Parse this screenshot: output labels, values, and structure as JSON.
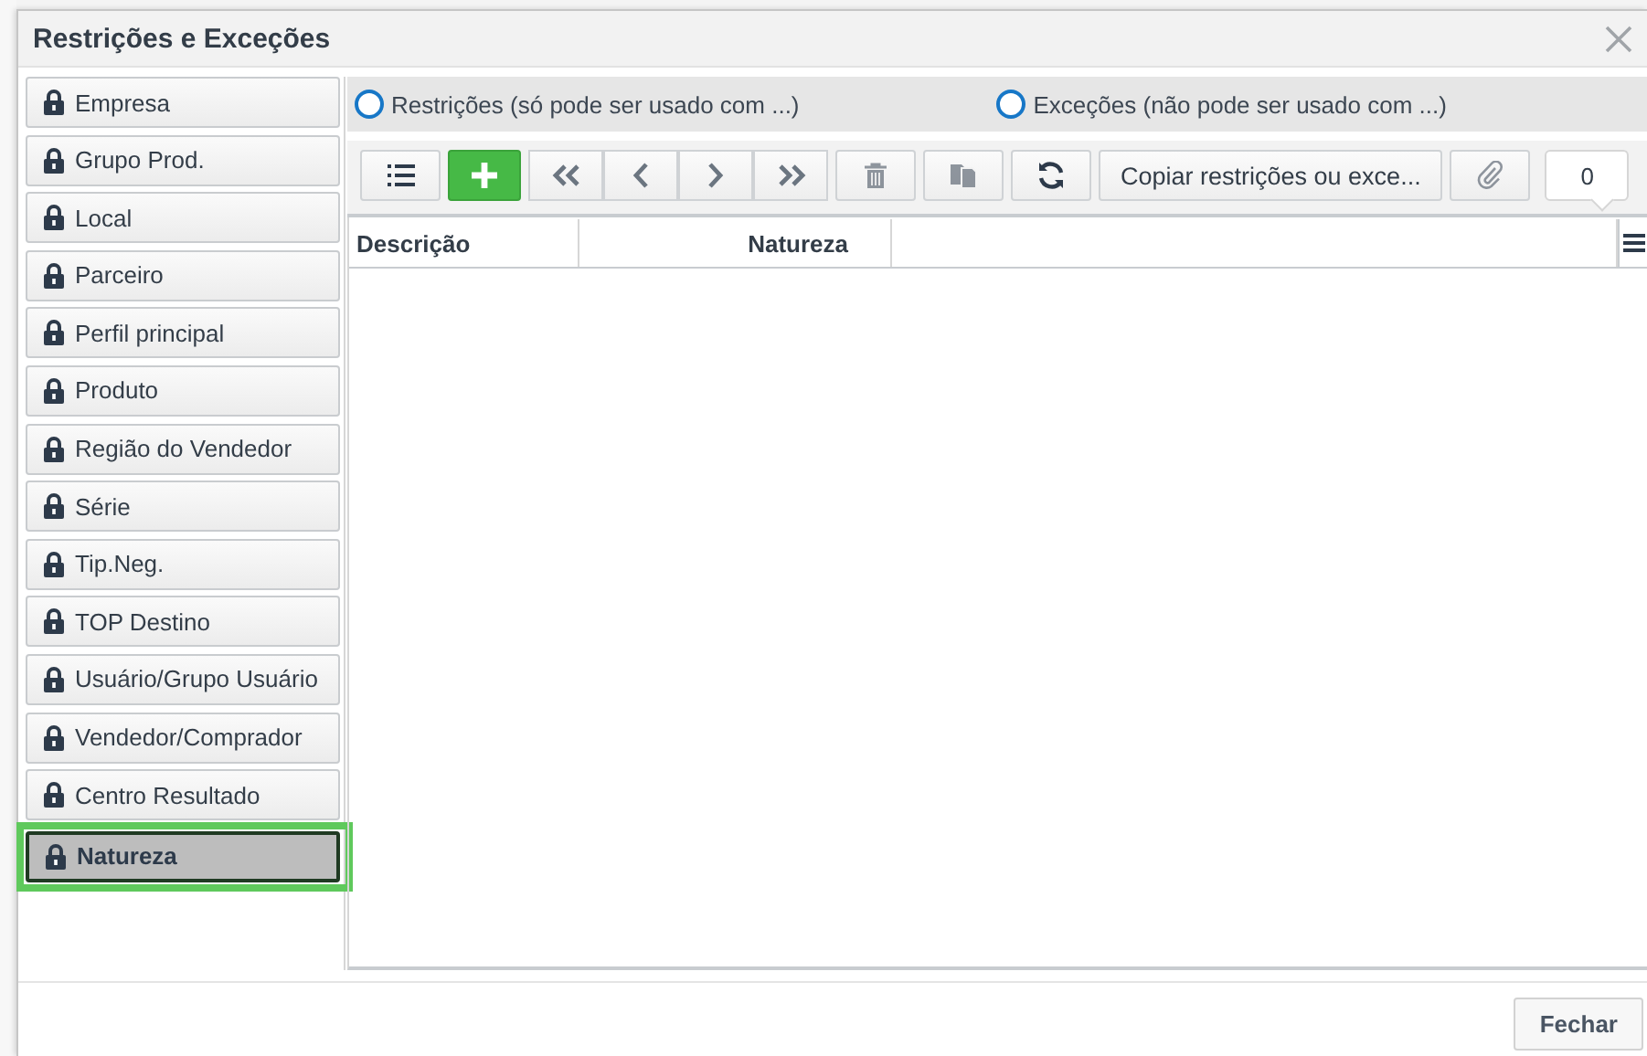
{
  "window": {
    "title": "Restrições e Exceções"
  },
  "sidebar": {
    "items": [
      {
        "label": "Empresa",
        "selected": false
      },
      {
        "label": "Grupo Prod.",
        "selected": false
      },
      {
        "label": "Local",
        "selected": false
      },
      {
        "label": "Parceiro",
        "selected": false
      },
      {
        "label": "Perfil principal",
        "selected": false
      },
      {
        "label": "Produto",
        "selected": false
      },
      {
        "label": "Região do Vendedor",
        "selected": false
      },
      {
        "label": "Série",
        "selected": false
      },
      {
        "label": "Tip.Neg.",
        "selected": false
      },
      {
        "label": "TOP Destino",
        "selected": false
      },
      {
        "label": "Usuário/Grupo Usuário",
        "selected": false
      },
      {
        "label": "Vendedor/Comprador",
        "selected": false
      },
      {
        "label": "Centro Resultado",
        "selected": false
      },
      {
        "label": "Natureza",
        "selected": true
      }
    ]
  },
  "mode": {
    "options": [
      {
        "label": "Restrições (só pode ser usado com ...)",
        "selected": false
      },
      {
        "label": "Exceções (não pode ser usado com ...)",
        "selected": false
      }
    ]
  },
  "toolbar": {
    "items": [
      {
        "kind": "list",
        "disabled": false
      },
      {
        "kind": "add",
        "disabled": false
      },
      {
        "kind": "first",
        "disabled": false
      },
      {
        "kind": "prev",
        "disabled": false
      },
      {
        "kind": "next",
        "disabled": false
      },
      {
        "kind": "last",
        "disabled": false
      },
      {
        "kind": "delete",
        "disabled": true
      },
      {
        "kind": "duplicate",
        "disabled": true
      },
      {
        "kind": "refresh",
        "disabled": false
      },
      {
        "kind": "text",
        "label": "Copiar restrições ou exce...",
        "disabled": false
      },
      {
        "kind": "attach",
        "disabled": true
      },
      {
        "kind": "counter",
        "label": "0"
      }
    ]
  },
  "table": {
    "columns": [
      "Descrição",
      "Natureza"
    ]
  },
  "footer": {
    "buttons": [
      "Fechar"
    ]
  }
}
